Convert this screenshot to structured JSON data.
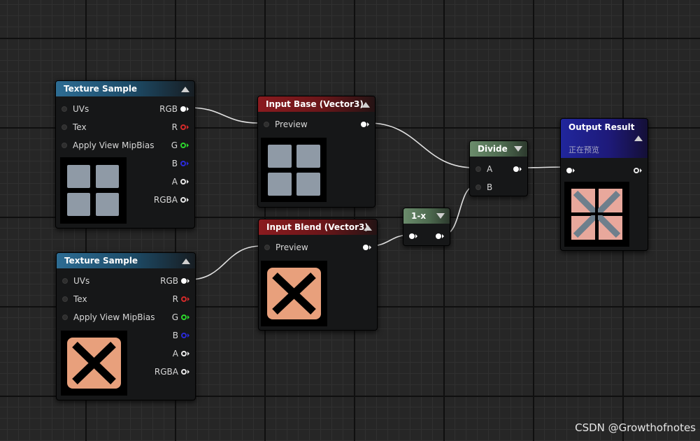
{
  "nodes": {
    "texture_sample_1": {
      "title": "Texture Sample",
      "inputs": [
        "UVs",
        "Tex",
        "Apply View MipBias"
      ],
      "outputs": [
        "RGB",
        "R",
        "G",
        "B",
        "A",
        "RGBA"
      ]
    },
    "texture_sample_2": {
      "title": "Texture Sample",
      "inputs": [
        "UVs",
        "Tex",
        "Apply View MipBias"
      ],
      "outputs": [
        "RGB",
        "R",
        "G",
        "B",
        "A",
        "RGBA"
      ]
    },
    "input_base": {
      "title": "Input Base (Vector3)",
      "pin": "Preview"
    },
    "input_blend": {
      "title": "Input Blend (Vector3)",
      "pin": "Preview"
    },
    "one_minus": {
      "title": "1-x"
    },
    "divide": {
      "title": "Divide",
      "inputs": [
        "A",
        "B"
      ]
    },
    "output_result": {
      "title": "Output Result",
      "subtitle": "正在预览"
    }
  },
  "colors": {
    "header_texture": "#1d4b67",
    "header_input": "#8a1b1f",
    "header_math": "#4e6b50",
    "header_output": "#20269c",
    "pin_r": "#d42a2a",
    "pin_g": "#2cd62c",
    "pin_b": "#2a2ad8",
    "wire": "#e0e0e0",
    "thumb_gray": "#8f9aa6",
    "thumb_orange": "#e8a07c"
  },
  "icons": {
    "collapse": "triangle-up-icon",
    "expand": "triangle-down-icon"
  },
  "watermark": "CSDN @Growthofnotes"
}
